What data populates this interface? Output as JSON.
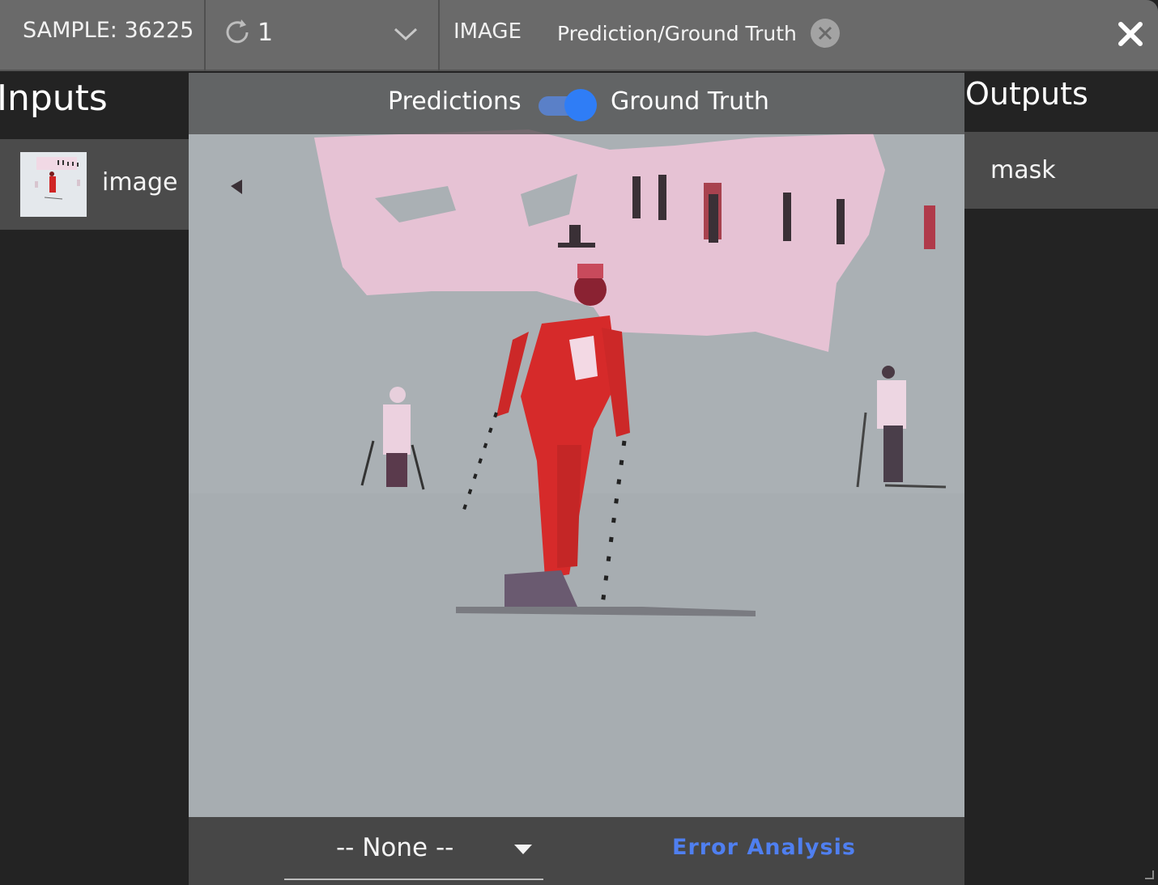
{
  "header": {
    "sample_label": "SAMPLE: 36225",
    "iteration_value": "1",
    "image_label": "IMAGE",
    "chip_label": "Prediction/Ground Truth"
  },
  "inputs": {
    "title": "Inputs",
    "items": [
      {
        "label": "image"
      }
    ]
  },
  "outputs": {
    "title": "Outputs",
    "items": [
      {
        "label": "mask"
      }
    ]
  },
  "viewer": {
    "toggle_left_label": "Predictions",
    "toggle_right_label": "Ground Truth",
    "toggle_on": true
  },
  "footer": {
    "select_value": "-- None --",
    "error_analysis_label": "Error Analysis"
  },
  "colors": {
    "accent_blue": "#2f7df6",
    "link_blue": "#4f7ff0",
    "mask_pink": "#f0c6dc",
    "skier_red": "#d42a2a"
  },
  "icons": [
    "refresh-icon",
    "chevron-down-icon",
    "chip-close-icon",
    "close-icon",
    "caret-down-icon"
  ]
}
